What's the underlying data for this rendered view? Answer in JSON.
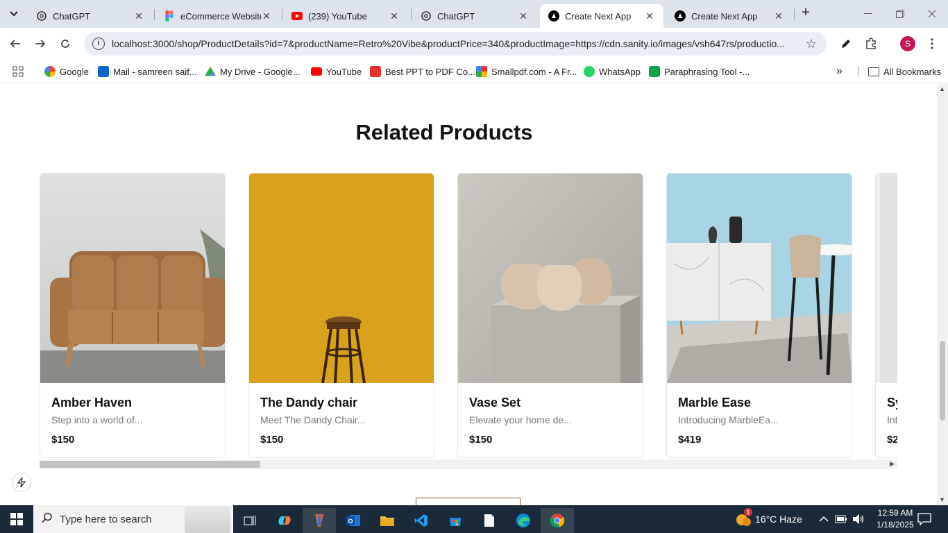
{
  "browser": {
    "tabs": [
      {
        "title": "ChatGPT",
        "icon": "chatgpt-icon"
      },
      {
        "title": "eCommerce Website",
        "icon": "figma-icon"
      },
      {
        "title": "(239) YouTube",
        "icon": "youtube-icon"
      },
      {
        "title": "ChatGPT",
        "icon": "chatgpt-icon"
      },
      {
        "title": "Create Next App",
        "icon": "nextjs-icon",
        "active": true
      },
      {
        "title": "Create Next App",
        "icon": "nextjs-icon"
      }
    ],
    "url": "localhost:3000/shop/ProductDetails?id=7&productName=Retro%20Vibe&productPrice=340&productImage=https://cdn.sanity.io/images/vsh647rs/productio...",
    "profile_initial": "S",
    "bookmarks": [
      {
        "label": "Google",
        "icon": "google-icon"
      },
      {
        "label": "Mail - samreen saif...",
        "icon": "outlook-icon"
      },
      {
        "label": "My Drive - Google...",
        "icon": "drive-icon"
      },
      {
        "label": "YouTube",
        "icon": "youtube-icon"
      },
      {
        "label": "Best PPT to PDF Co...",
        "icon": "pdf-icon"
      },
      {
        "label": "Smallpdf.com - A Fr...",
        "icon": "smallpdf-icon"
      },
      {
        "label": "WhatsApp",
        "icon": "whatsapp-icon"
      },
      {
        "label": "Paraphrasing Tool -...",
        "icon": "quillbot-icon"
      }
    ],
    "all_bookmarks": "All Bookmarks"
  },
  "page": {
    "section_title": "Related Products",
    "products": [
      {
        "name": "Amber Haven",
        "description": "Step into a world of...",
        "price": "$150"
      },
      {
        "name": "The Dandy chair",
        "description": "Meet The Dandy Chair...",
        "price": "$150"
      },
      {
        "name": "Vase Set",
        "description": "Elevate your home de...",
        "price": "$150"
      },
      {
        "name": "Marble Ease",
        "description": "Introducing MarbleEa...",
        "price": "$419"
      },
      {
        "name": "Sy",
        "description": "Int",
        "price": "$2"
      }
    ]
  },
  "taskbar": {
    "search_placeholder": "Type here to search",
    "weather": "16°C  Haze",
    "notification_count": "1",
    "time": "12:59 AM",
    "date": "1/18/2025"
  },
  "colors": {
    "tabstrip": "#dde3ea",
    "omnibox": "#e9eef6",
    "profile": "#c2185b",
    "taskbar": "#1b2a3a",
    "dandy_bg": "#d9a21c"
  }
}
